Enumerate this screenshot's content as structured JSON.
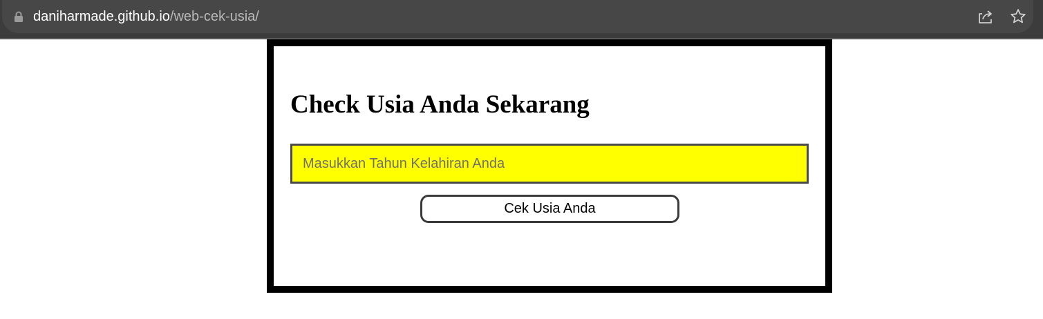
{
  "browser": {
    "url_host": "daniharmade.github.io",
    "url_path": "/web-cek-usia/",
    "icons": [
      "lock-icon",
      "share-icon",
      "star-icon"
    ]
  },
  "page": {
    "title": "Check Usia Anda Sekarang",
    "input": {
      "placeholder": "Masukkan Tahun Kelahiran Anda",
      "value": ""
    },
    "button_label": "Cek Usia Anda",
    "colors": {
      "input_background": "#ffff00",
      "card_border": "#000000"
    }
  }
}
